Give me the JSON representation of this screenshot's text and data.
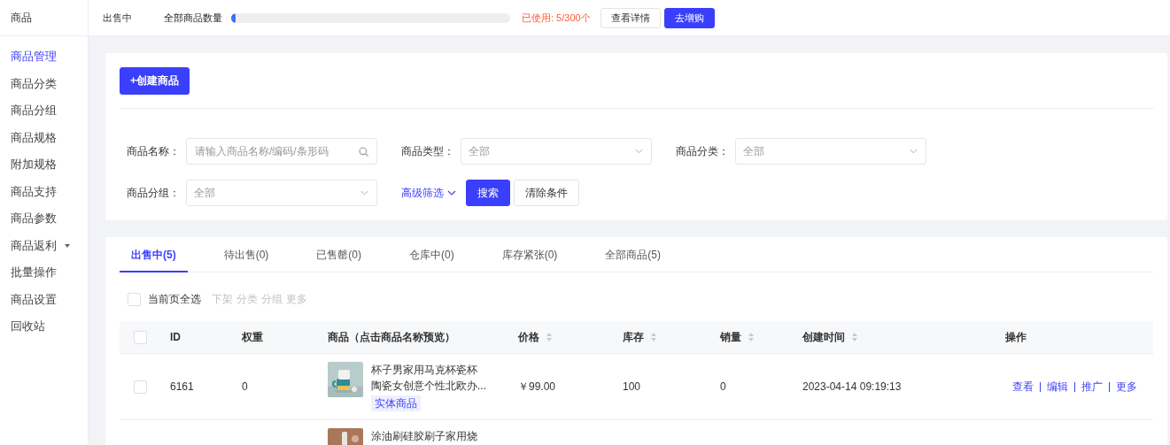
{
  "sidebar": {
    "title": "商品",
    "items": [
      {
        "label": "商品管理",
        "selected": true,
        "expandable": false
      },
      {
        "label": "商品分类",
        "selected": false,
        "expandable": false
      },
      {
        "label": "商品分组",
        "selected": false,
        "expandable": false
      },
      {
        "label": "商品规格",
        "selected": false,
        "expandable": false
      },
      {
        "label": "附加规格",
        "selected": false,
        "expandable": false
      },
      {
        "label": "商品支持",
        "selected": false,
        "expandable": false
      },
      {
        "label": "商品参数",
        "selected": false,
        "expandable": false
      },
      {
        "label": "商品返利",
        "selected": false,
        "expandable": true
      },
      {
        "label": "批量操作",
        "selected": false,
        "expandable": false
      },
      {
        "label": "商品设置",
        "selected": false,
        "expandable": false
      },
      {
        "label": "回收站",
        "selected": false,
        "expandable": false
      }
    ]
  },
  "top_bar": {
    "status": "出售中",
    "quota_label": "全部商品数量",
    "quota": {
      "level": 0.017
    },
    "usage": "已使用: 5/300个",
    "buttons": [
      {
        "label": "查看详情",
        "kind": "secondary"
      },
      {
        "label": "去增购",
        "kind": "primary"
      }
    ]
  },
  "filter_card": {
    "create_button": "+创建商品",
    "fields": [
      {
        "label": "商品名称：",
        "kind": "search",
        "placeholder": "请输入商品名称/编码/条形码"
      },
      {
        "label": "商品类型：",
        "kind": "select",
        "value": "全部"
      },
      {
        "label": "商品分类：",
        "kind": "select",
        "value": "全部"
      },
      {
        "label": "商品分组：",
        "kind": "select",
        "value": "全部"
      }
    ],
    "advanced_filter": "高级筛选",
    "buttons": [
      {
        "label": "搜索",
        "kind": "primary"
      },
      {
        "label": "清除条件",
        "kind": "secondary"
      }
    ]
  },
  "product_list": {
    "tabs": [
      {
        "label": "出售中(5)",
        "selected": true
      },
      {
        "label": "待出售(0)",
        "selected": false
      },
      {
        "label": "已售罄(0)",
        "selected": false
      },
      {
        "label": "仓库中(0)",
        "selected": false
      },
      {
        "label": "库存紧张(0)",
        "selected": false
      },
      {
        "label": "全部商品(5)",
        "selected": false
      }
    ],
    "select_all": {
      "label": "当前页全选",
      "checked": false
    },
    "bulk_actions": [
      {
        "label": "下架",
        "disabled": true
      },
      {
        "label": "分类",
        "disabled": true
      },
      {
        "label": "分组",
        "disabled": true
      },
      {
        "label": "更多",
        "disabled": true
      }
    ],
    "table": {
      "columns": [
        {
          "kind": "checkbox",
          "checked": false
        },
        {
          "kind": "text",
          "label": "ID"
        },
        {
          "kind": "text",
          "label": "权重"
        },
        {
          "kind": "text",
          "label": "商品（点击商品名称预览）"
        },
        {
          "kind": "text",
          "label": "价格",
          "sortable": true
        },
        {
          "kind": "text",
          "label": "库存",
          "sortable": true
        },
        {
          "kind": "text",
          "label": "销量",
          "sortable": true
        },
        {
          "kind": "text",
          "label": "创建时间",
          "sortable": true
        },
        {
          "kind": "text",
          "label": "操作"
        }
      ],
      "rows": [
        {
          "checked": false,
          "id": "6161",
          "weight": "0",
          "product": {
            "name_lines": [
              "杯子男家用马克杯瓷杯",
              "陶瓷女创意个性北欧办..."
            ],
            "tag": "实体商品",
            "image": {
              "kind": "picture"
            }
          },
          "price": "￥99.00",
          "stock": "100",
          "sales": "0",
          "created": "2023-04-14 09:19:13",
          "actions": [
            "查看",
            "编辑",
            "推广",
            "更多"
          ]
        },
        {
          "product": {
            "name_lines": [
              "涂油刷硅胶刷子家用烧"
            ],
            "image": {
              "kind": "picture"
            }
          }
        }
      ]
    }
  }
}
